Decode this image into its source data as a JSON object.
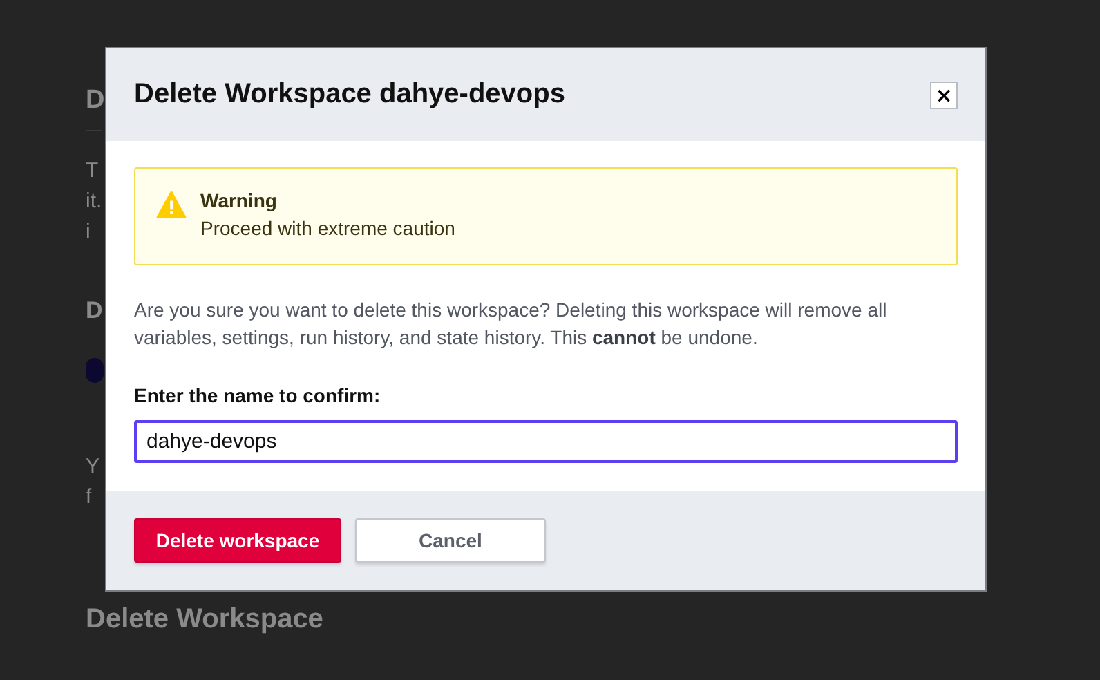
{
  "background_page": {
    "heading": "D",
    "intro_lines": [
      "T",
      "it.",
      "i"
    ],
    "subheading": "D",
    "note_lines": [
      "Y",
      "f"
    ],
    "section_heading": "Delete Workspace"
  },
  "dialog": {
    "title": "Delete Workspace dahye-devops",
    "close_button": "×",
    "warning": {
      "title": "Warning",
      "message": "Proceed with extreme caution"
    },
    "message": "Are you sure you want to delete this workspace? Deleting this workspace will remove all variables, settings, run history, and state history. This **cannot** be undone.",
    "confirm_label": "Enter the name to confirm:",
    "name_input": {
      "value": "dahye-devops"
    },
    "buttons": [
      {
        "label": "Delete workspace",
        "kind": "danger"
      },
      {
        "label": "Cancel",
        "kind": "secondary"
      }
    ]
  }
}
